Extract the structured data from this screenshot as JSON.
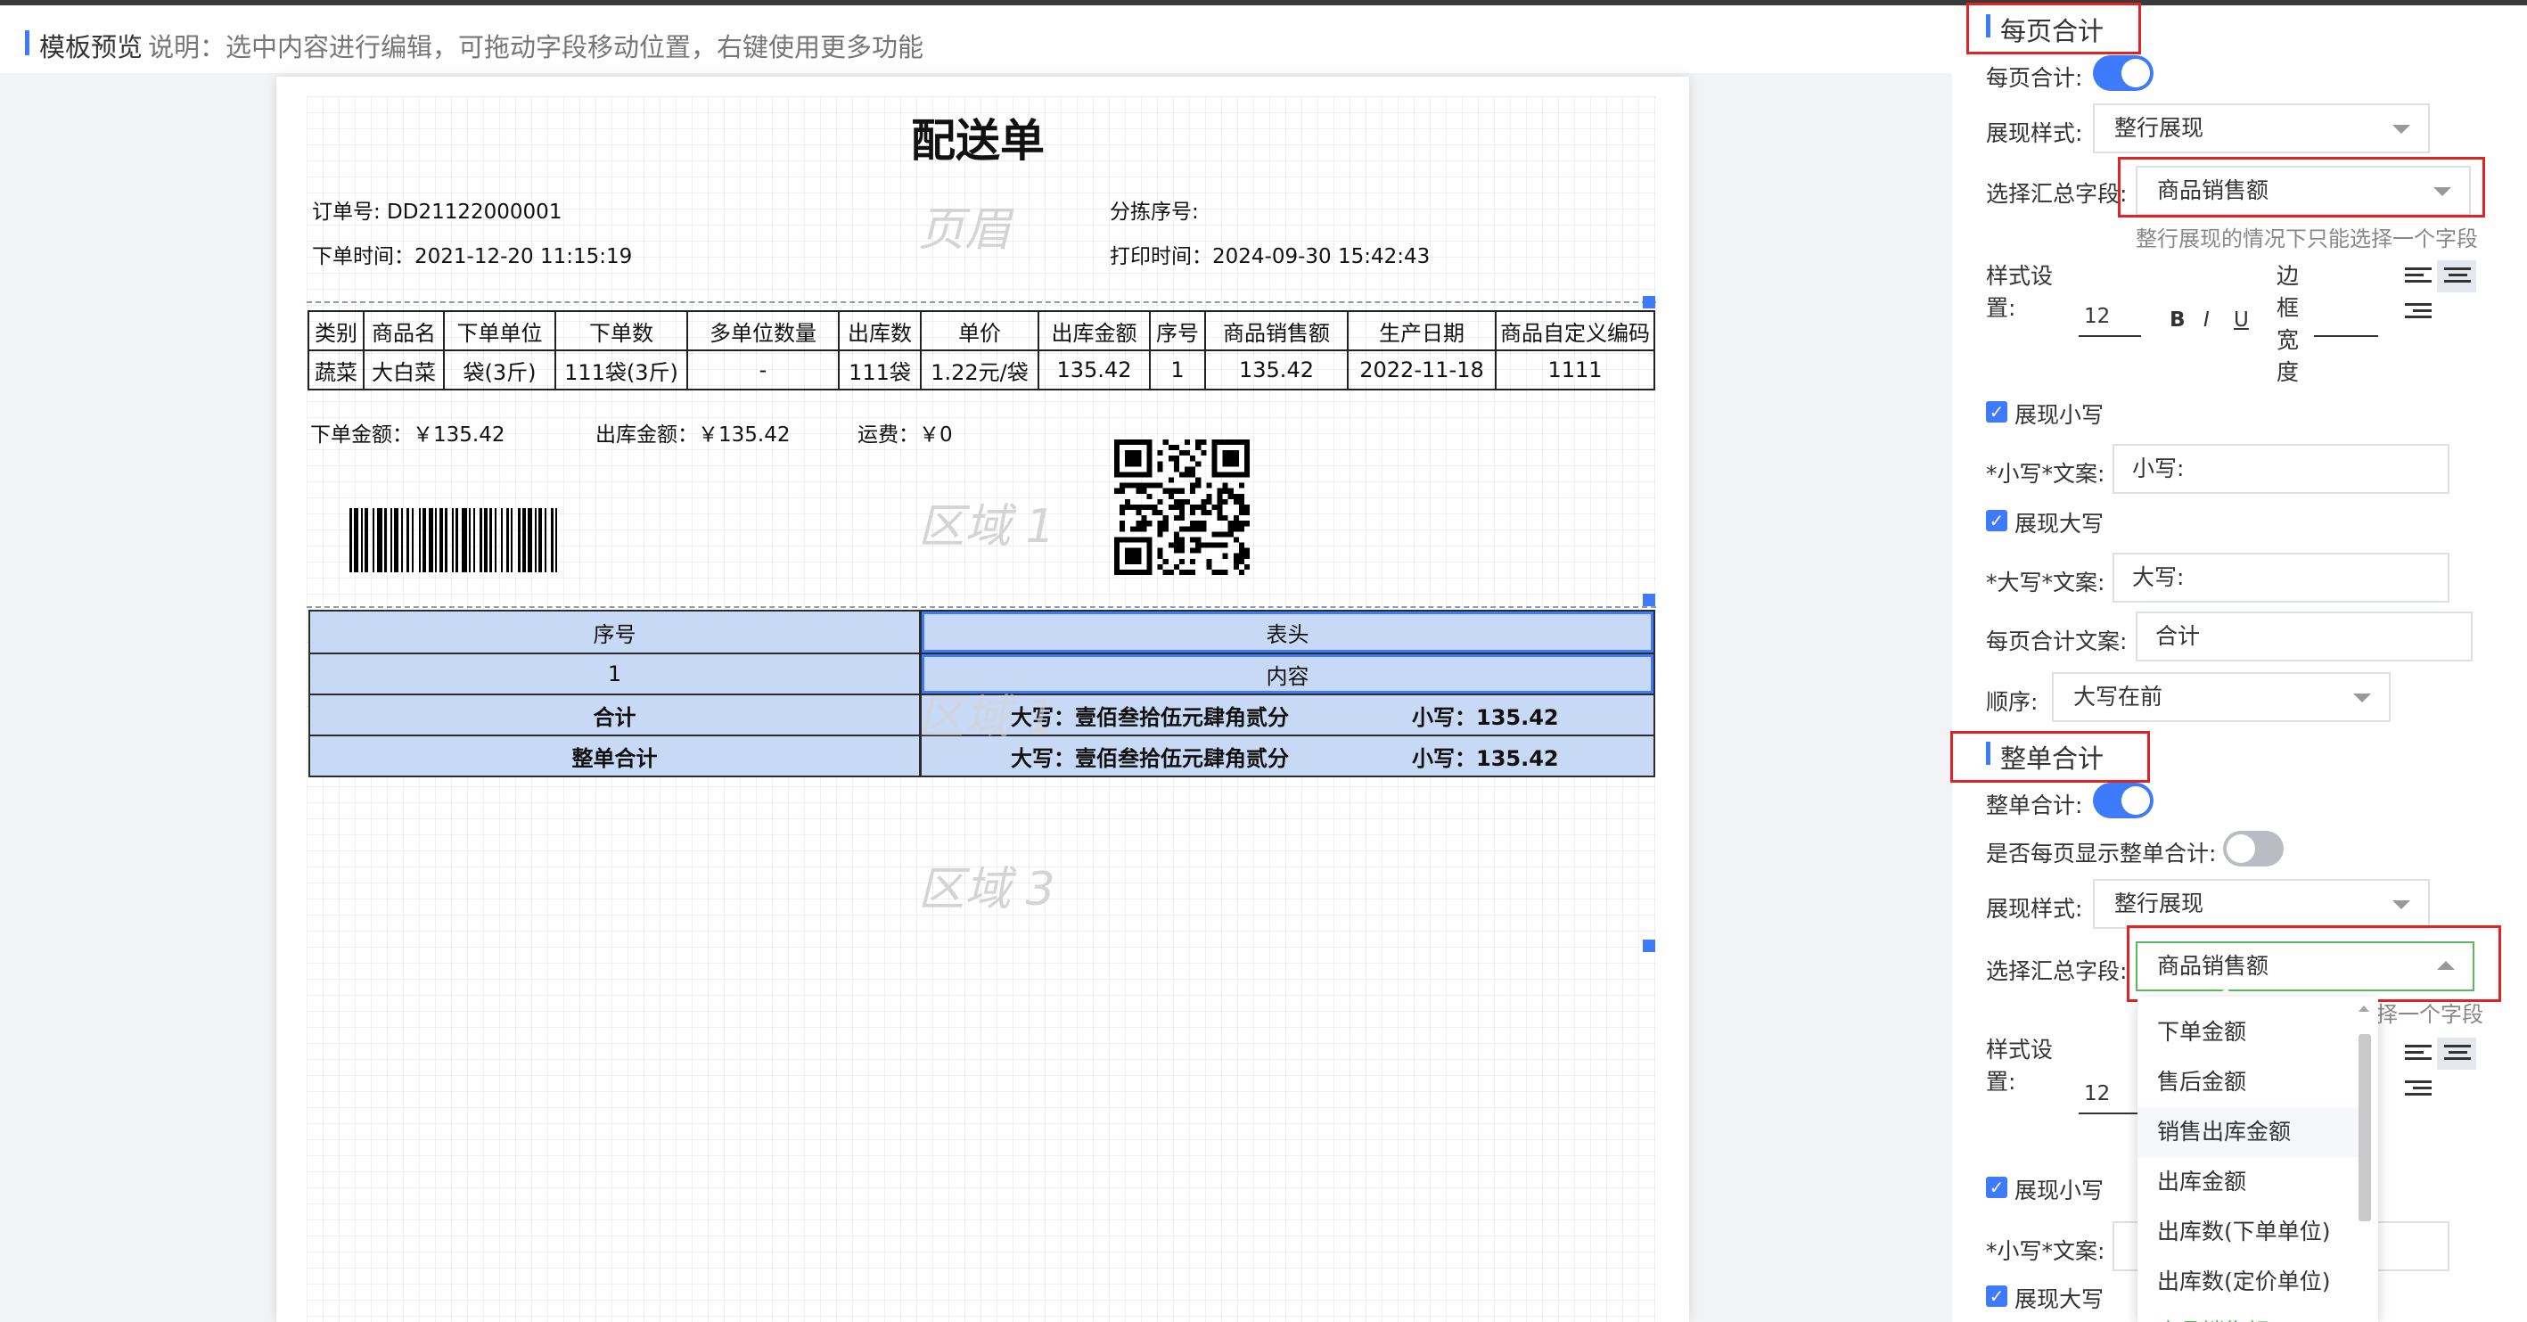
{
  "header": {
    "title": "模板预览",
    "description": "说明：选中内容进行编辑，可拖动字段移动位置，右键使用更多功能"
  },
  "document": {
    "title": "配送单",
    "order_no": "订单号: DD21122000001",
    "sort_no": "分拣序号:",
    "order_time": "下单时间：2021-12-20 11:15:19",
    "print_time": "打印时间：2024-09-30 15:42:43",
    "watermarks": {
      "header": "页眉",
      "area1": "区域 1",
      "area2": "区域 1",
      "area3": "区域 3",
      "table": "区域 2"
    },
    "columns": [
      "类别",
      "商品名",
      "下单单位",
      "下单数",
      "多单位数量",
      "出库数",
      "单价",
      "出库金额",
      "序号",
      "商品销售额",
      "生产日期",
      "商品自定义编码"
    ],
    "rows": [
      [
        "蔬菜",
        "大白菜",
        "袋(3斤)",
        "111袋(3斤)",
        "-",
        "111袋",
        "1.22元/袋",
        "135.42",
        "1",
        "135.42",
        "2022-11-18",
        "1111"
      ]
    ],
    "order_amount": "下单金额：￥135.42",
    "out_amount": "出库金额：￥135.42",
    "freight": "运费：￥0",
    "summary": {
      "head_left": "序号",
      "head_right": "表头",
      "body_left": "1",
      "body_right": "内容",
      "page_total_label": "合计",
      "page_total_big": "大写：壹佰叁拾伍元肆角贰分",
      "page_total_small": "小写：135.42",
      "grand_total_label": "整单合计",
      "grand_total_big": "大写：壹佰叁拾伍元肆角贰分",
      "grand_total_small": "小写：135.42"
    }
  },
  "panel": {
    "page_total": {
      "section_title": "每页合计",
      "toggle_label": "每页合计:",
      "toggle_on": true,
      "style_label": "展现样式:",
      "style_value": "整行展现",
      "field_label": "选择汇总字段:",
      "field_value": "商品销售额",
      "hint": "整行展现的情况下只能选择一个字段",
      "format_label": "样式设置:",
      "font_size": "12",
      "bold": "B",
      "italic": "I",
      "underline": "U",
      "border_label": "边框宽度",
      "show_small_label": "展现小写",
      "small_text_label": "*小写*文案:",
      "small_text_value": "小写:",
      "show_big_label": "展现大写",
      "big_text_label": "*大写*文案:",
      "big_text_value": "大写:",
      "total_text_label": "每页合计文案:",
      "total_text_value": "合计",
      "order_label": "顺序:",
      "order_value": "大写在前"
    },
    "grand_total": {
      "section_title": "整单合计",
      "toggle_label": "整单合计:",
      "toggle_on": true,
      "each_page_label": "是否每页显示整单合计:",
      "each_page_on": false,
      "style_label": "展现样式:",
      "style_value": "整行展现",
      "field_label": "选择汇总字段:",
      "field_value": "商品销售额",
      "hint_partial": "择一个字段",
      "format_label": "样式设置:",
      "font_size": "12",
      "show_small_label": "展现小写",
      "small_text_label": "*小写*文案:",
      "show_big_label": "展现大写"
    },
    "dropdown_options": [
      "下单金额",
      "售后金额",
      "销售出库金额",
      "出库金额",
      "出库数(下单单位)",
      "出库数(定价单位)",
      "商品销售额"
    ]
  },
  "colors": {
    "accent": "#3e7bfa",
    "highlight_red": "#e02424",
    "summary_fill": "#c7d9f4",
    "focus_green": "#5fb761"
  }
}
